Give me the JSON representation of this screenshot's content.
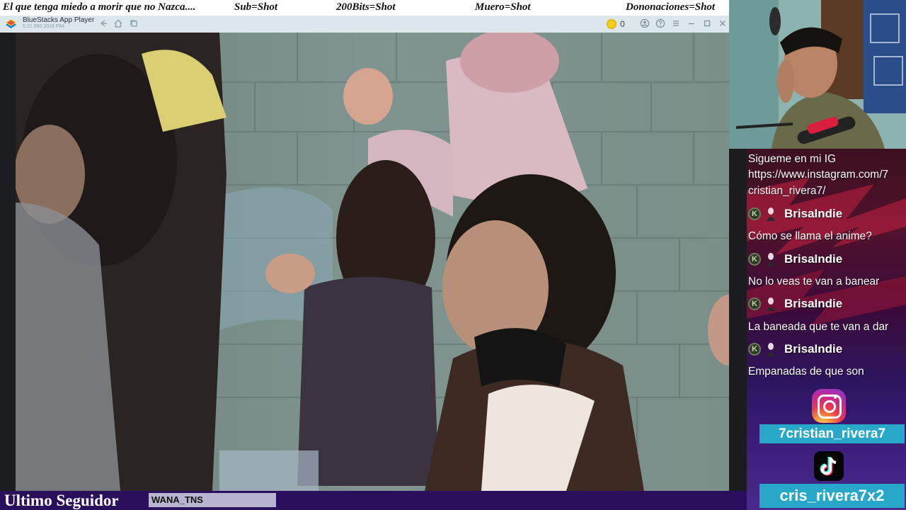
{
  "ticker": {
    "item1": "El que tenga miedo a morir que no Nazca....",
    "item2": "Sub=Shot",
    "item3": "200Bits=Shot",
    "item4": "Muero=Shot",
    "item5": "Dononaciones=Shot"
  },
  "window": {
    "app_title": "BlueStacks App Player",
    "version": "5.21.650.1019 P64",
    "coin_count": "0",
    "icons": [
      "back-icon",
      "home-icon",
      "multi-instance-icon",
      "account-icon",
      "help-icon",
      "menu-icon",
      "minimize-icon",
      "maximize-icon",
      "close-icon"
    ]
  },
  "chat": {
    "pinned": [
      "Sigueme en mi IG",
      "https://www.instagram.com/7",
      "cristian_rivera7/"
    ],
    "messages": [
      {
        "user": "BrisaIndie",
        "text": "Cómo se llama el anime?"
      },
      {
        "user": "BrisaIndie",
        "text": "No lo veas te van a banear"
      },
      {
        "user": "BrisaIndie",
        "text": "La baneada que te van a dar"
      },
      {
        "user": "BrisaIndie",
        "text": "Empanadas de que son"
      }
    ],
    "badge_letter": "K"
  },
  "socials": {
    "instagram_handle": "7cristian_rivera7",
    "tiktok_handle": "cris_rivera7x2"
  },
  "footer": {
    "last_follower_label": "Ultimo Seguidor",
    "last_follower_name": "WANA_TNS"
  },
  "colors": {
    "accent": "#27a8c8",
    "footer_bg": "#2a0f5c",
    "titlebar_bg": "#dbe7ea"
  }
}
